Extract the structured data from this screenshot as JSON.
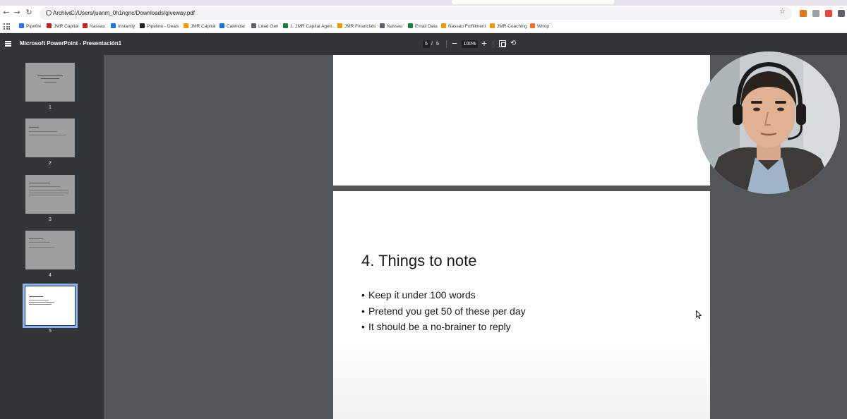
{
  "browser": {
    "omnibox": {
      "chip_label": "Archive",
      "url": "C:/Users/juanm_0h1ngnc/Downloads/giveway.pdf"
    },
    "bookmarks": [
      {
        "label": "Pipefile",
        "color": "#2d6ff7"
      },
      {
        "label": "JMR Capital",
        "color": "#c5221f"
      },
      {
        "label": "Nassau",
        "color": "#c5221f"
      },
      {
        "label": "Instantly",
        "color": "#1a73e8"
      },
      {
        "label": "Pipeline - Deals",
        "color": "#202124"
      },
      {
        "label": "JMR Capital",
        "color": "#f29900"
      },
      {
        "label": "Calendar",
        "color": "#1a73e8"
      },
      {
        "label": "Lead Gen",
        "color": "#5f6368"
      },
      {
        "label": "1. JMR Capital Agen...",
        "color": "#188038"
      },
      {
        "label": "JMR Financials",
        "color": "#f29900"
      },
      {
        "label": "Nassau",
        "color": "#5f6368"
      },
      {
        "label": "Email Data",
        "color": "#188038"
      },
      {
        "label": "Nassau Fulfillment",
        "color": "#f29900"
      },
      {
        "label": "JMR Coaching",
        "color": "#f29900"
      },
      {
        "label": "Whop",
        "color": "#fa6f22"
      }
    ]
  },
  "viewer": {
    "title": "Microsoft PowerPoint - Presentación1",
    "current_page": "5",
    "page_separator": "/",
    "total_pages": "5",
    "zoom": "100%",
    "zoom_out": "−",
    "zoom_in": "+"
  },
  "thumbnails": [
    {
      "number": "1",
      "active": false
    },
    {
      "number": "2",
      "active": false
    },
    {
      "number": "3",
      "active": false
    },
    {
      "number": "4",
      "active": false
    },
    {
      "number": "5",
      "active": true
    }
  ],
  "slide": {
    "title": "4. Things to note",
    "bullets": [
      "Keep it under 100 words",
      "Pretend you get 50 of these per day",
      "It should be a no-brainer to reply"
    ]
  },
  "icons": {
    "back": "arrow-left-icon",
    "forward": "arrow-right-icon",
    "reload": "reload-icon",
    "star": "star-icon",
    "menu": "hamburger-menu-icon",
    "fit": "fit-page-icon",
    "rotate": "rotate-icon"
  }
}
